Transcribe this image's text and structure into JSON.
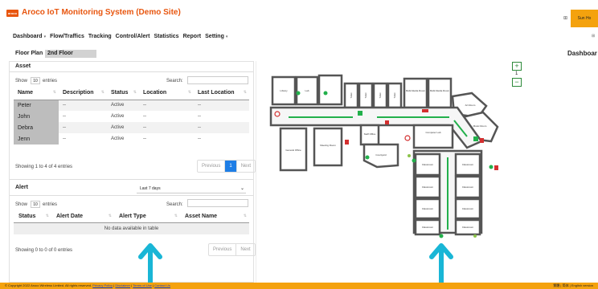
{
  "header": {
    "logo_text": "aroco",
    "title": "Aroco IoT Monitoring System (Demo Site)",
    "grid_icon": "grid-icon",
    "user": "Sun Ho"
  },
  "nav": {
    "items": [
      {
        "label": "Dashboard",
        "caret": "▾"
      },
      {
        "label": "Flow/Traffics",
        "caret": ""
      },
      {
        "label": "Tracking",
        "caret": ""
      },
      {
        "label": "Control/Alert",
        "caret": ""
      },
      {
        "label": "Statistics",
        "caret": ""
      },
      {
        "label": "Report",
        "caret": ""
      },
      {
        "label": "Setting",
        "caret": "▾"
      }
    ]
  },
  "floor_plan": {
    "label": "Floor Plan",
    "selected": "2nd Floor"
  },
  "dashboard_label": "Dashboar",
  "asset": {
    "title": "Asset",
    "show": "Show",
    "entries_count": "10",
    "entries": "entries",
    "search": "Search:",
    "columns": [
      "Name",
      "Description",
      "Status",
      "Location",
      "Last Location"
    ],
    "rows": [
      {
        "name": "Peter",
        "description": "--",
        "status": "Active",
        "location": "--",
        "last": "--"
      },
      {
        "name": "John",
        "description": "--",
        "status": "Active",
        "location": "--",
        "last": "--"
      },
      {
        "name": "Debra",
        "description": "--",
        "status": "Active",
        "location": "--",
        "last": "--"
      },
      {
        "name": "Jenn",
        "description": "--",
        "status": "Active",
        "location": "--",
        "last": "--"
      }
    ],
    "info": "Showing 1 to 4 of 4 entries",
    "pager": {
      "prev": "Previous",
      "page": "1",
      "next": "Next"
    }
  },
  "alert": {
    "title": "Alert",
    "period": "Last 7 days",
    "show": "Show",
    "entries_count": "10",
    "entries": "entries",
    "search": "Search:",
    "columns": [
      "Status",
      "Alert Date",
      "Alert Type",
      "Asset Name"
    ],
    "empty": "No data available in table",
    "info": "Showing 0 to 0 of 0 entries",
    "pager": {
      "prev": "Previous",
      "next": "Next"
    }
  },
  "map": {
    "zoom_in": "+",
    "zoom_level": "1",
    "zoom_out": "−",
    "rooms": [
      "Library",
      "Lab",
      "Multi-Media Room",
      "Multi-Media Room",
      "Art Room",
      "Music Room",
      "Computer Lab",
      "Staff Office",
      "General Office",
      "Meeting Room",
      "Courtyard",
      "Classroom",
      "Classroom",
      "Classroom",
      "Classroom",
      "Classroom",
      "Classroom",
      "Classroom",
      "Classroom",
      "Toilet",
      "Toilet",
      "Toilet",
      "Toilet"
    ]
  },
  "footer": {
    "copyright": "© Copyright 2022 Aroco Wireless Limited. All rights reserved.",
    "privacy": "Privacy Policy",
    "disclaimer": "Disclaimer",
    "terms": "Terms of Use",
    "contact": "Contact Us",
    "lang": "繁體 | 简体 | English",
    "version": "version"
  },
  "colors": {
    "accent": "#e8560f",
    "footer": "#f4a20e",
    "pager_active": "#1e7ee6",
    "arrow": "#19b6d6",
    "path": "#22b04b"
  }
}
